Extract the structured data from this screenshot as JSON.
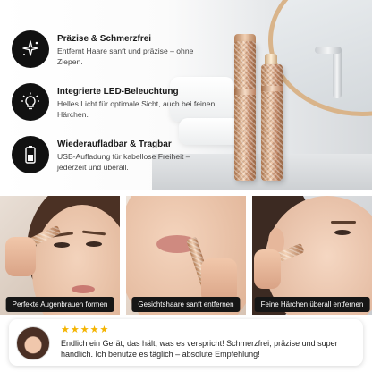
{
  "features": [
    {
      "icon": "sparkle-icon",
      "title": "Präzise & Schmerzfrei",
      "desc": "Entfernt Haare sanft und präzise – ohne Ziepen."
    },
    {
      "icon": "lightbulb-icon",
      "title": "Integrierte LED-Beleuchtung",
      "desc": "Helles Licht für optimale Sicht, auch bei feinen Härchen."
    },
    {
      "icon": "battery-icon",
      "title": "Wiederaufladbar & Tragbar",
      "desc": "USB-Aufladung für kabellose Freiheit – jederzeit und überall."
    }
  ],
  "photos": [
    {
      "caption": "Perfekte Augenbrauen formen"
    },
    {
      "caption": "Gesichtshaare sanft entfernen"
    },
    {
      "caption": "Feine Härchen überall entfernen"
    }
  ],
  "review": {
    "stars": "★★★★★",
    "text": "Endlich ein Gerät, das hält, was es verspricht! Schmerzfrei, präzise und super handlich. Ich benutze es täglich – absolute Empfehlung!"
  },
  "colors": {
    "accent_gold": "#e8c2a3",
    "star": "#f4b400",
    "icon_bg": "#111111"
  }
}
